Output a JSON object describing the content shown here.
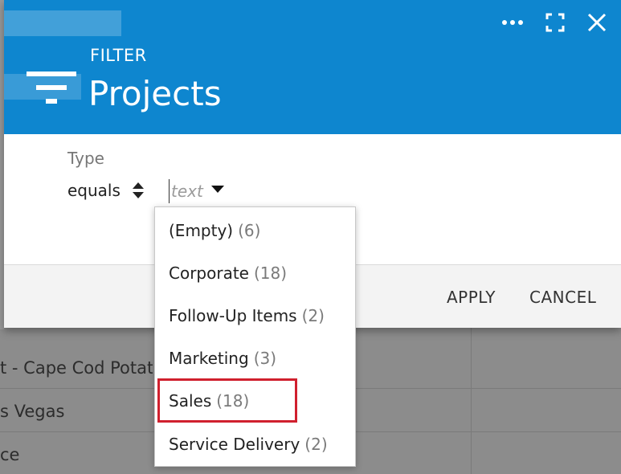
{
  "background": {
    "rows": [
      {
        "text": "t - Cape Cod Potato"
      },
      {
        "text": "s Vegas"
      },
      {
        "text": "ce"
      }
    ]
  },
  "dialog": {
    "subtitle": "FILTER",
    "title": "Projects",
    "accent_color": "#0e86cf",
    "icons": [
      "more-icon",
      "maximize-icon",
      "close-icon",
      "filter-icon"
    ]
  },
  "filter": {
    "field_label": "Type",
    "operator": "equals",
    "value": "",
    "placeholder": "text"
  },
  "dropdown": {
    "items": [
      {
        "label": "(Empty)",
        "count": "(6)"
      },
      {
        "label": "Corporate",
        "count": "(18)"
      },
      {
        "label": "Follow-Up Items",
        "count": "(2)"
      },
      {
        "label": "Marketing",
        "count": "(3)"
      },
      {
        "label": "Sales",
        "count": "(18)"
      },
      {
        "label": "Service Delivery",
        "count": "(2)"
      }
    ],
    "highlighted_index": 4,
    "highlight_color": "#d0202e"
  },
  "footer": {
    "apply_label": "APPLY",
    "cancel_label": "CANCEL"
  }
}
